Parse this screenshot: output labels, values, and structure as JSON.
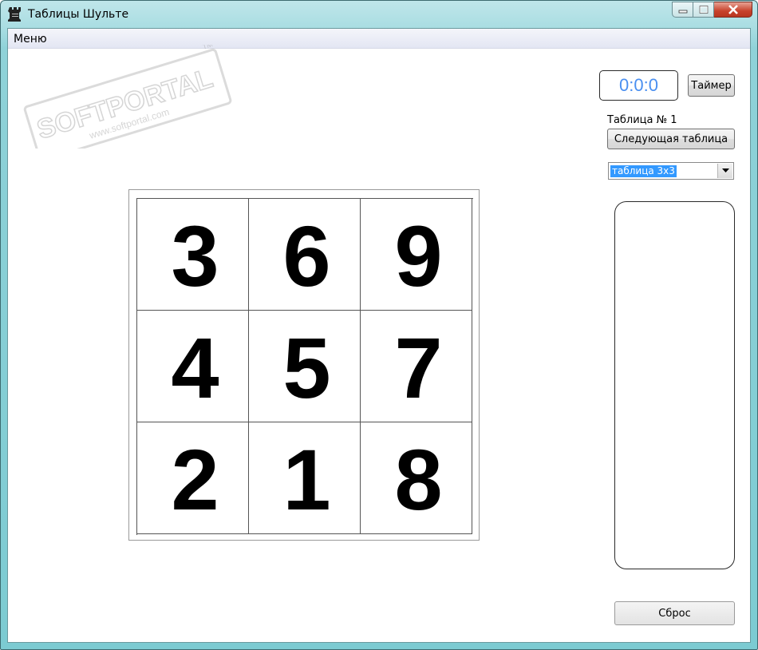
{
  "window": {
    "title": "Таблицы Шульте"
  },
  "menu": {
    "items": [
      "Меню"
    ]
  },
  "watermark": {
    "text": "SOFTPORTAL",
    "url": "www.softportal.com",
    "tm": "TM"
  },
  "grid": {
    "cells": [
      "3",
      "6",
      "9",
      "4",
      "5",
      "7",
      "2",
      "1",
      "8"
    ]
  },
  "timer": {
    "display": "0:0:0",
    "button_label": "Таймер"
  },
  "table": {
    "label": "Таблица № 1",
    "next_label": "Следующая таблица",
    "selected_option": "таблица 3х3"
  },
  "reset": {
    "label": "Сброс"
  },
  "colors": {
    "timer_text": "#4a8ff0",
    "selection": "#3399ff",
    "frame": "#8fd2d8"
  }
}
